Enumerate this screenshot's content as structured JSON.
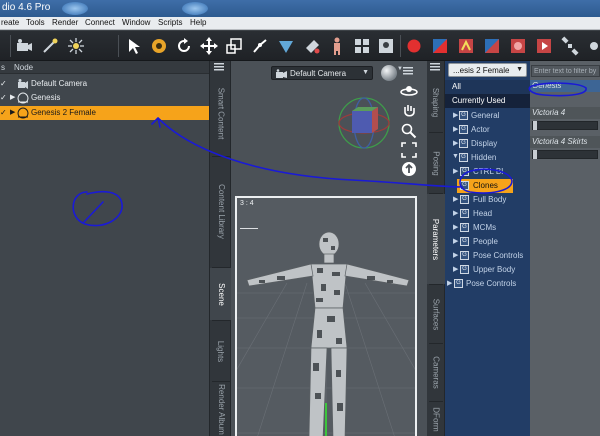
{
  "window": {
    "title": "dio 4.6 Pro"
  },
  "menu": [
    "reate",
    "Tools",
    "Render",
    "Connect",
    "Window",
    "Scripts",
    "Help"
  ],
  "scene": {
    "col_node": "Node",
    "col_left": "s",
    "rows": [
      {
        "label": "Default Camera",
        "icon": "camera-icon"
      },
      {
        "label": "Genesis",
        "icon": "figure-icon"
      },
      {
        "label": "Genesis 2 Female",
        "icon": "figure-icon",
        "selected": true
      }
    ]
  },
  "left_tabs": [
    "Smart Content",
    "Content Library",
    "Scene",
    "Lights",
    "Render Album"
  ],
  "viewport": {
    "camera": "Default Camera",
    "aspect": "3 : 4"
  },
  "param_tabs": [
    "Shaping",
    "Posing",
    "Parameters",
    "Surfaces",
    "Cameras",
    "DForm"
  ],
  "parameters": {
    "figure": "...esis 2 Female",
    "top_items": [
      "All",
      "Currently Used"
    ],
    "categories": [
      {
        "label": "General",
        "level": 0
      },
      {
        "label": "Actor",
        "level": 0
      },
      {
        "label": "Display",
        "level": 0
      },
      {
        "label": "Hidden",
        "level": 0,
        "expanded": true
      },
      {
        "label": "CTRL BI",
        "level": 1
      },
      {
        "label": "Clones",
        "level": 1,
        "selected": true
      },
      {
        "label": "Full Body",
        "level": 1
      },
      {
        "label": "Head",
        "level": 1
      },
      {
        "label": "MCMs",
        "level": 1
      },
      {
        "label": "People",
        "level": 1
      },
      {
        "label": "Pose Controls",
        "level": 1
      },
      {
        "label": "Upper Body",
        "level": 1
      },
      {
        "label": "Pose Controls",
        "level": 0
      }
    ]
  },
  "sliders": {
    "filter_placeholder": "Enter text to filter by",
    "groups": [
      {
        "label": "Genesis",
        "value": 0.0
      },
      {
        "label": "Victoria 4",
        "value": 0.0
      },
      {
        "label": "Victoria 4 Skirts",
        "value": 0.0
      }
    ]
  },
  "colors": {
    "selection": "#f6a31a",
    "param_bg": "#223d66",
    "annotation": "#1a1ad6"
  }
}
